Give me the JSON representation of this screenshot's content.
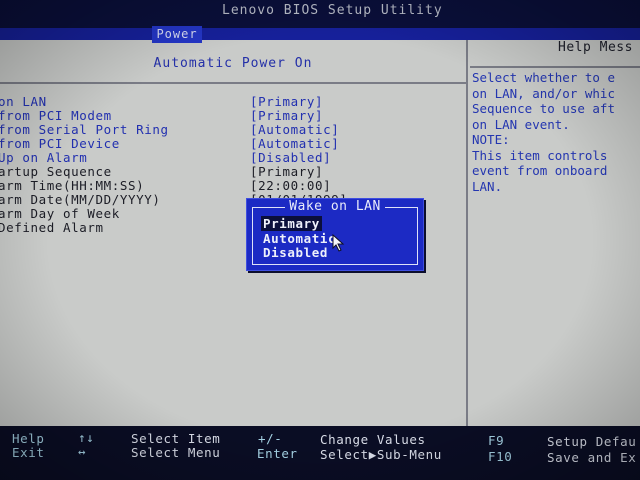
{
  "app": {
    "title": "Lenovo BIOS Setup Utility",
    "active_tab": "Power"
  },
  "main": {
    "section_title": "Automatic Power On",
    "settings": [
      {
        "label": "on LAN",
        "value": "[Primary]",
        "editable": true
      },
      {
        "label": "from PCI Modem",
        "value": "[Primary]",
        "editable": true
      },
      {
        "label": "from Serial Port Ring",
        "value": "[Automatic]",
        "editable": true
      },
      {
        "label": "from PCI Device",
        "value": "[Automatic]",
        "editable": true
      },
      {
        "label": "Up on Alarm",
        "value": "[Disabled]",
        "editable": true
      },
      {
        "label": "artup Sequence",
        "value": "[Primary]",
        "editable": false
      },
      {
        "label": "arm Time(HH:MM:SS)",
        "value": "[22:00:00]",
        "editable": false
      },
      {
        "label": "arm Date(MM/DD/YYYY)",
        "value": "[01/01/1999]",
        "editable": false
      },
      {
        "label": "arm Day of Week",
        "value": "",
        "editable": false
      },
      {
        "label": "Defined Alarm",
        "value": "",
        "editable": false
      }
    ]
  },
  "help": {
    "title": "Help Mess",
    "lines": [
      "Select whether to e",
      "on LAN, and/or whic",
      "Sequence to use aft",
      "on LAN event.",
      "NOTE:",
      "This item controls",
      "event from onboard",
      "LAN."
    ]
  },
  "popup": {
    "title": "Wake on LAN",
    "options": [
      "Primary",
      "Automatic",
      "Disabled"
    ],
    "selected_index": 0
  },
  "footer": {
    "items": [
      {
        "key": "Help",
        "desc": "Select Item"
      },
      {
        "key": "Exit",
        "desc": "Select Menu"
      },
      {
        "key": "↑↓",
        "desc": ""
      },
      {
        "key": "↔",
        "desc": ""
      },
      {
        "key": "+/-",
        "desc": "Change Values"
      },
      {
        "key": "Enter",
        "desc": "Select▶Sub-Menu"
      },
      {
        "key": "F9",
        "desc": "Setup Defau"
      },
      {
        "key": "F10",
        "desc": "Save and Ex"
      }
    ]
  },
  "colors": {
    "screen_bg": "#c9cbc9",
    "title_bar": "#0a0f3a",
    "tab_active": "#2436c6",
    "label_blue": "#2230b0",
    "popup_bg": "#1c2ac4",
    "footer_bg": "#0a0d24"
  },
  "icons": {
    "cursor": "mouse-pointer-icon"
  }
}
